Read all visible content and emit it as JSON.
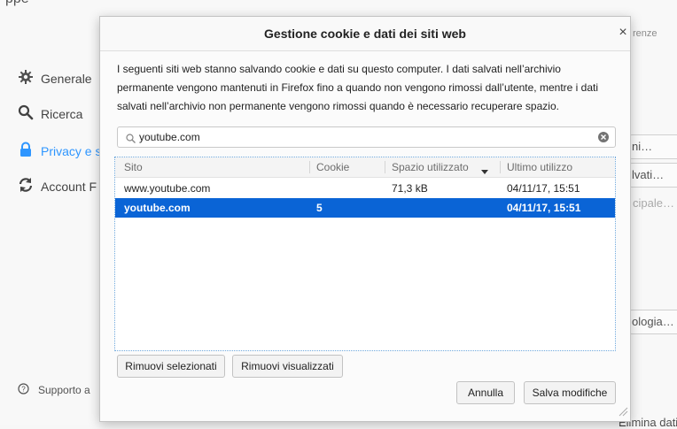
{
  "background": {
    "header_fragment": "ppe",
    "sidebar": {
      "items": [
        {
          "label": "Generale",
          "icon": "gear-icon"
        },
        {
          "label": "Ricerca",
          "icon": "search-icon"
        },
        {
          "label": "Privacy e s",
          "icon": "lock-icon"
        },
        {
          "label": "Account F",
          "icon": "sync-icon"
        }
      ],
      "support_label": "Supporto a"
    },
    "right_column": {
      "prefs_fragment": "renze",
      "btn1": "ni…",
      "btn2": "lvati…",
      "text1": "cipale…",
      "btn3": "ologia…",
      "bottom_fragment": "Elimina dati…"
    }
  },
  "dialog": {
    "title": "Gestione cookie e dati dei siti web",
    "close_symbol": "×",
    "description": "I seguenti siti web stanno salvando cookie e dati su questo computer. I dati salvati nell’archivio permanente vengono mantenuti in Firefox fino a quando non vengono rimossi dall’utente, mentre i dati salvati nell’archivio non permanente vengono rimossi quando è necessario recuperare spazio.",
    "search": {
      "value": "youtube.com",
      "placeholder": ""
    },
    "table": {
      "columns": [
        "Sito",
        "Cookie",
        "Spazio utilizzato",
        "Ultimo utilizzo"
      ],
      "rows": [
        {
          "site": "www.youtube.com",
          "cookie": "",
          "space": "71,3 kB",
          "last_used": "04/11/17, 15:51",
          "selected": false
        },
        {
          "site": "youtube.com",
          "cookie": "5",
          "space": "",
          "last_used": "04/11/17, 15:51",
          "selected": true
        }
      ]
    },
    "buttons": {
      "remove_selected": "Rimuovi selezionati",
      "remove_shown": "Rimuovi visualizzati",
      "cancel": "Annulla",
      "save": "Salva modifiche"
    }
  }
}
